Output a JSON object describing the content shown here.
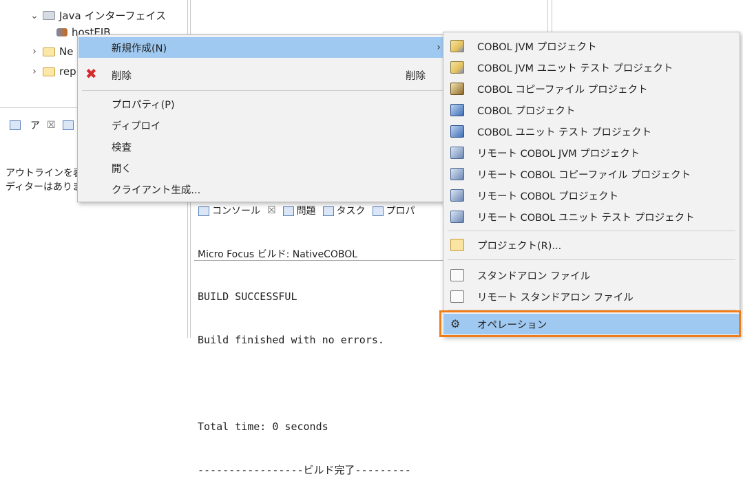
{
  "tree": {
    "items": [
      {
        "label": "Java インターフェイス",
        "expanded": true
      },
      {
        "label": "hostEJB"
      },
      {
        "label": "Ne"
      },
      {
        "label": "rep"
      }
    ]
  },
  "outline_panel": {
    "tab_label": "ア",
    "close_glyph": "☒",
    "message_line1": "アウトラインを表",
    "message_line2": "ディターはありま"
  },
  "console_tabs": {
    "console": "コンソール",
    "close_glyph": "☒",
    "problems": "問題",
    "tasks": "タスク",
    "properties": "プロパ"
  },
  "console": {
    "header": "Micro Focus ビルド: NativeCOBOL",
    "lines": [
      "BUILD SUCCESSFUL",
      "Build finished with no errors.",
      "",
      "Total time: 0 seconds",
      "-----------------ビルド完了---------"
    ]
  },
  "context_menu": {
    "new": {
      "label": "新規作成(N)",
      "arrow": "›"
    },
    "delete": {
      "label": "削除",
      "accelerator": "削除"
    },
    "properties": {
      "label": "プロパティ(P)"
    },
    "deploy": {
      "label": "ディプロイ"
    },
    "inspect": {
      "label": "検査"
    },
    "open": {
      "label": "開く"
    },
    "generate_client": {
      "label": "クライアント生成..."
    }
  },
  "submenu": {
    "items": [
      {
        "label": "COBOL JVM プロジェクト",
        "icon": "cobol-jvm-project-icon"
      },
      {
        "label": "COBOL JVM ユニット テスト プロジェクト",
        "icon": "cobol-jvm-unit-test-icon"
      },
      {
        "label": "COBOL コピーファイル プロジェクト",
        "icon": "cobol-copyfile-project-icon"
      },
      {
        "label": "COBOL プロジェクト",
        "icon": "cobol-project-icon"
      },
      {
        "label": "COBOL ユニット テスト プロジェクト",
        "icon": "cobol-unit-test-icon"
      },
      {
        "label": "リモート COBOL JVM プロジェクト",
        "icon": "remote-cobol-jvm-icon"
      },
      {
        "label": "リモート COBOL コピーファイル プロジェクト",
        "icon": "remote-copyfile-icon"
      },
      {
        "label": "リモート COBOL プロジェクト",
        "icon": "remote-cobol-project-icon"
      },
      {
        "label": "リモート COBOL ユニット テスト プロジェクト",
        "icon": "remote-unit-test-icon"
      },
      {
        "label": "プロジェクト(R)...",
        "icon": "project-icon"
      },
      {
        "label": "スタンドアロン ファイル",
        "icon": "standalone-file-icon"
      },
      {
        "label": "リモート スタンドアロン ファイル",
        "icon": "remote-standalone-file-icon"
      },
      {
        "label": "オペレーション",
        "icon": "operation-icon",
        "highlighted": true
      }
    ]
  },
  "colors": {
    "highlight": "#9fc9f0",
    "frame": "#f07d1a"
  }
}
